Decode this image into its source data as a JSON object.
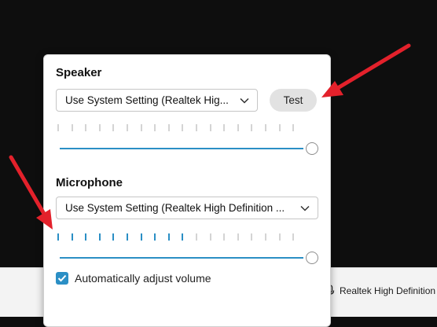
{
  "speaker": {
    "title": "Speaker",
    "device_selected": "Use System Setting (Realtek Hig...",
    "test_label": "Test",
    "volume_fraction": 1.0,
    "meter_active_ticks": 0,
    "meter_total_ticks": 18
  },
  "microphone": {
    "title": "Microphone",
    "device_selected": "Use System Setting (Realtek High Definition ...",
    "volume_fraction": 1.0,
    "meter_active_ticks": 10,
    "meter_total_ticks": 18,
    "auto_adjust_label": "Automatically adjust volume",
    "auto_adjust_checked": true
  },
  "background": {
    "device_label": "Realtek High Definition"
  },
  "colors": {
    "accent": "#2b8fc5",
    "annotation_arrow": "#e3212b"
  }
}
